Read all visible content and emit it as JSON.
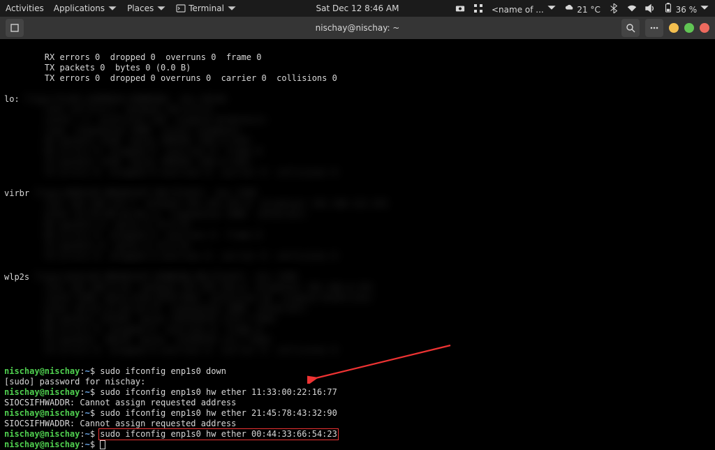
{
  "panel": {
    "activities": "Activities",
    "applications": "Applications",
    "places": "Places",
    "terminal_menu": "Terminal",
    "clock": "Sat Dec 12  8:46 AM",
    "music_player": "<name of ...",
    "temperature": "21 °C",
    "battery_percent": "36 %"
  },
  "window": {
    "title": "nischay@nischay: ~"
  },
  "terminal": {
    "rx_errors": "        RX errors 0  dropped 0  overruns 0  frame 0",
    "tx_packets": "        TX packets 0  bytes 0 (0.0 B)",
    "tx_errors": "        TX errors 0  dropped 0 overruns 0  carrier 0  collisions 0",
    "lo_label": "lo:",
    "virbr_label": "virbr",
    "wlp_label_1": "wlp2s",
    "wlp_label_2": "wlp2s",
    "blur_placeholder": "████████████████████████████████████████████████████████████████████████████████████████████████████████",
    "prompt_userhost": "nischay@nischay",
    "prompt_colon": ":",
    "prompt_path": "~",
    "prompt_dollar": "$ ",
    "cmd_down": "sudo ifconfig enp1s0 down",
    "sudo_prompt": "[sudo] password for nischay:",
    "cmd_mac1": "sudo ifconfig enp1s0 hw ether 11:33:00:22:16:77",
    "err_sioc": "SIOCSIFHWADDR: Cannot assign requested address",
    "cmd_mac2": "sudo ifconfig enp1s0 hw ether 21:45:78:43:32:90",
    "cmd_mac3": "sudo ifconfig enp1s0 hw ether 00:44:33:66:54:23"
  }
}
